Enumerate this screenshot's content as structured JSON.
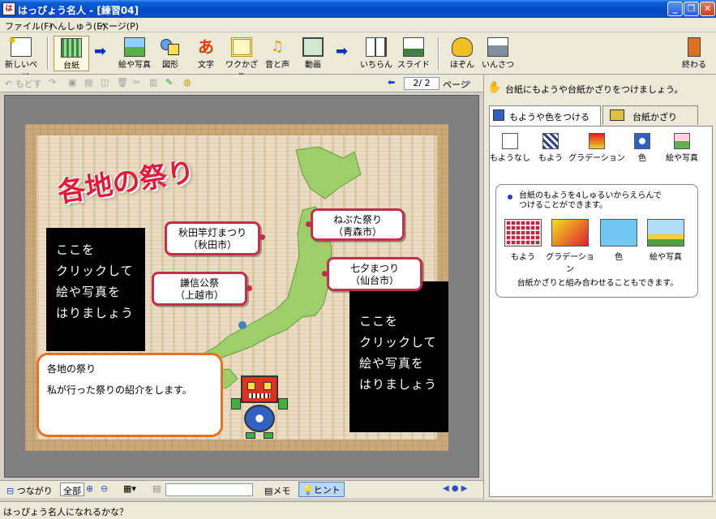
{
  "window": {
    "title": "はっぴょう名人 - [練習04]"
  },
  "menu": [
    "ファイル(F)",
    "へんしゅう(E)",
    "ページ(P)"
  ],
  "toolbar": {
    "new_page": "新しいページ",
    "board": "台紙",
    "picture": "絵や写真",
    "shape": "図形",
    "text": "文字",
    "frame": "ワクかざり",
    "sound": "音と声",
    "video": "動画",
    "list": "いちらん",
    "slide": "スライド",
    "save": "ほぞん",
    "print": "いんさつ",
    "exit": "終わる"
  },
  "edit_toolbar": {
    "undo": "もどす",
    "page_indicator": "2/ 2",
    "page_label": "ページ"
  },
  "slide": {
    "title": "各地の祭り",
    "placeholder_left": "ここを\nクリックして\n絵や写真を\nはりましょう",
    "placeholder_right": "ここを\nクリックして\n絵や写真を\nはりましょう",
    "callouts": [
      {
        "line1": "秋田竿灯まつり",
        "line2": "（秋田市）"
      },
      {
        "line1": "ねぶた祭り",
        "line2": "（青森市）"
      },
      {
        "line1": "七夕まつり",
        "line2": "（仙台市）"
      },
      {
        "line1": "謙信公祭",
        "line2": "（上越市）"
      }
    ],
    "note_title": "各地の祭り",
    "note_text": "私が行った祭りの紹介をします。"
  },
  "right_panel": {
    "hint": "台紙にもようや台紙かざりをつけましょう。",
    "tabs": [
      "もようや色をつける",
      "台紙かざり"
    ],
    "tools": [
      "もようなし",
      "もよう",
      "グラデーション",
      "色",
      "絵や写真"
    ],
    "info_text": "台紙のもようを4しゅるいからえらんで\nつけることができます。",
    "swatches": [
      "もよう",
      "グラデーション",
      "色",
      "絵や写真"
    ],
    "footer_text": "台紙かざりと組み合わせることもできます。"
  },
  "bottom_bar": {
    "links": "つながり",
    "zoom_all": "全部",
    "memo": "メモ",
    "hint": "ヒント"
  },
  "status": {
    "text": "はっぴょう名人になれるかな？"
  }
}
